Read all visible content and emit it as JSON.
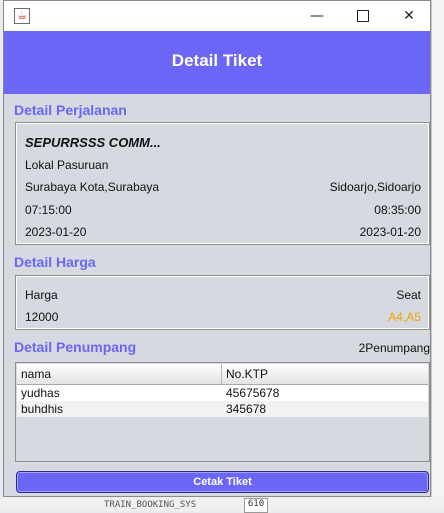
{
  "window": {
    "minimize_glyph": "—",
    "close_glyph": "✕",
    "app_icon_glyph": "☕"
  },
  "header": {
    "title": "Detail Tiket"
  },
  "perjalanan": {
    "section_title": "Detail Perjalanan",
    "train_name": "SEPURRSSS COMM...",
    "station": "Lokal Pasuruan",
    "origin": "Surabaya Kota,Surabaya",
    "destination": "Sidoarjo,Sidoarjo",
    "depart_time": "07:15:00",
    "arrive_time": "08:35:00",
    "depart_date": "2023-01-20",
    "arrive_date": "2023-01-20"
  },
  "harga": {
    "section_title": "Detail Harga",
    "price_label": "Harga",
    "seat_label": "Seat",
    "price_value": "12000",
    "seat_value": "A4,A5"
  },
  "penumpang": {
    "section_title": "Detail Penumpang",
    "count_label": "2Penumpang",
    "columns": [
      "nama",
      "No.KTP"
    ],
    "rows": [
      [
        "yudhas",
        "45675678"
      ],
      [
        "buhdhis",
        "345678"
      ]
    ]
  },
  "actions": {
    "print_label": "Cetak Tiket"
  },
  "background": {
    "bottom_text": "TRAIN_BOOKING_SYS",
    "bottom_box": "610"
  },
  "colors": {
    "accent": "#6b66f5",
    "seat": "#f0a500",
    "panel_bg": "#d6d9e0"
  }
}
